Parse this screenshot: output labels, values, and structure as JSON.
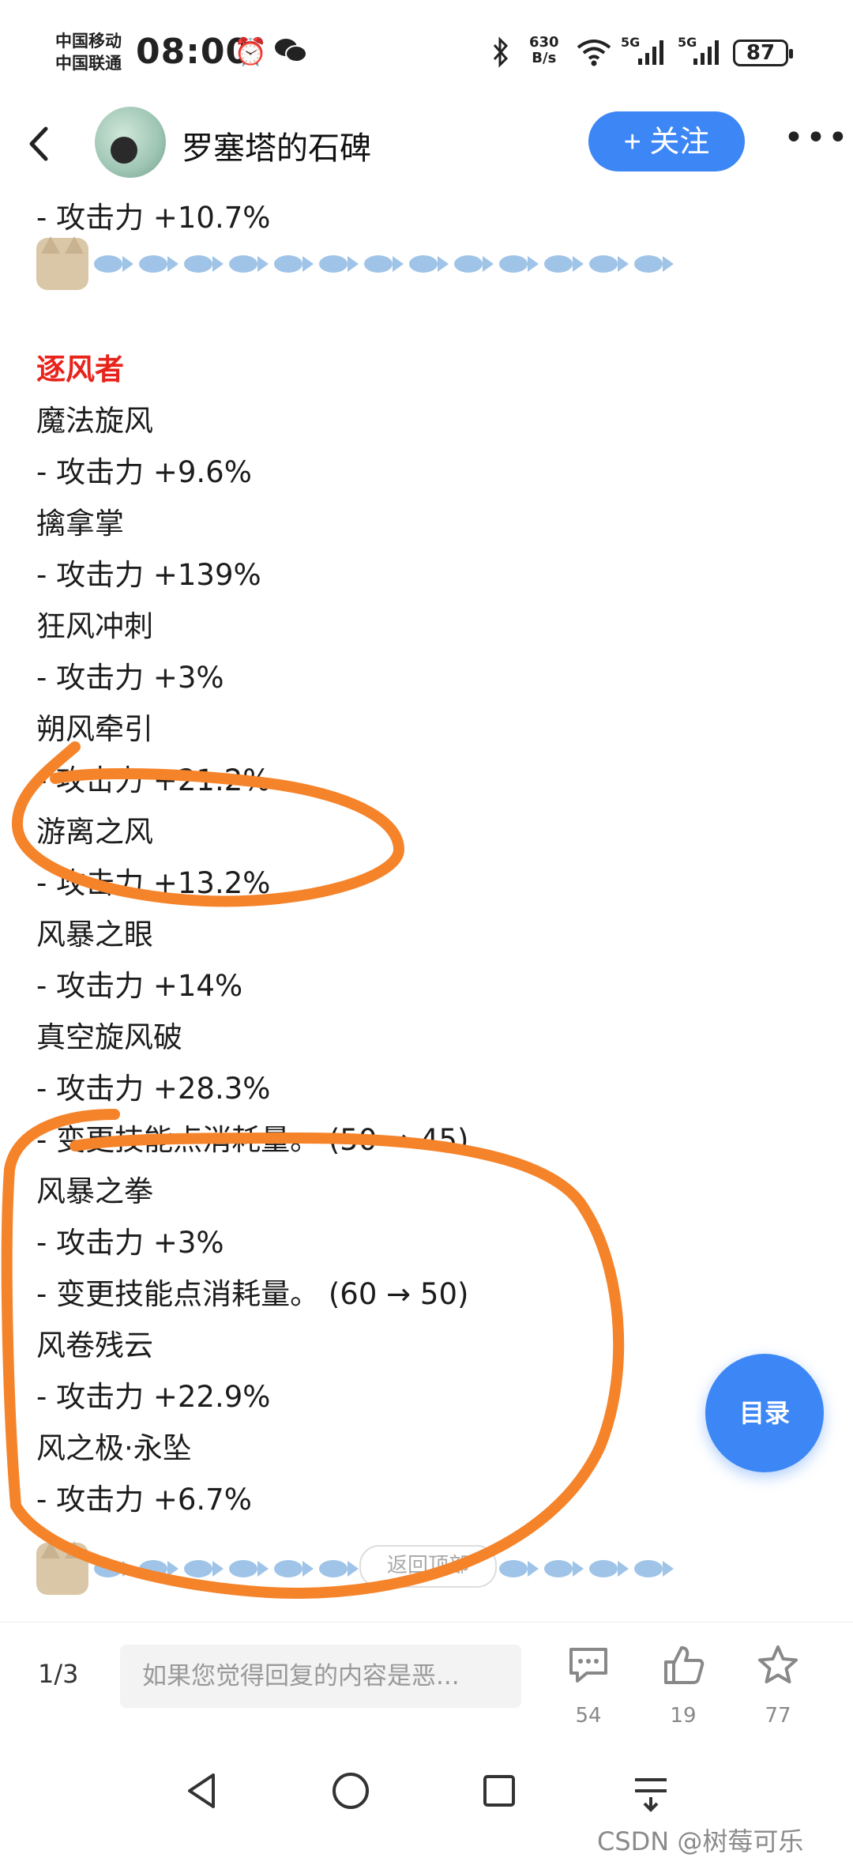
{
  "status": {
    "carrier1": "中国移动",
    "carrier2": "中国联通",
    "time": "08:00",
    "speed_value": "630",
    "speed_unit": "B/s",
    "sig1": "5G",
    "sig2": "5G",
    "battery": "87"
  },
  "header": {
    "username": "罗塞塔的石碑",
    "follow_label": "+ 关注"
  },
  "content": {
    "lines": [
      {
        "text": "- 攻击力 +10.7%",
        "type": "text"
      },
      {
        "text": "逐风者",
        "type": "title"
      },
      {
        "text": "魔法旋风",
        "type": "text"
      },
      {
        "text": "- 攻击力 +9.6%",
        "type": "text"
      },
      {
        "text": "擒拿掌",
        "type": "text"
      },
      {
        "text": "- 攻击力 +139%",
        "type": "text"
      },
      {
        "text": "狂风冲刺",
        "type": "text"
      },
      {
        "text": "- 攻击力 +3%",
        "type": "text"
      },
      {
        "text": "朔风牵引",
        "type": "text"
      },
      {
        "text": "- 攻击力 +21.2%",
        "type": "text"
      },
      {
        "text": "游离之风",
        "type": "text"
      },
      {
        "text": "- 攻击力 +13.2%",
        "type": "text"
      },
      {
        "text": "风暴之眼",
        "type": "text"
      },
      {
        "text": "- 攻击力 +14%",
        "type": "text"
      },
      {
        "text": "真空旋风破",
        "type": "text"
      },
      {
        "text": "- 攻击力 +28.3%",
        "type": "text"
      },
      {
        "text": "- 变更技能点消耗量。 (50 → 45)",
        "type": "text"
      },
      {
        "text": "风暴之拳",
        "type": "text"
      },
      {
        "text": "- 攻击力 +3%",
        "type": "text"
      },
      {
        "text": "- 变更技能点消耗量。 (60 → 50)",
        "type": "text"
      },
      {
        "text": "风卷残云",
        "type": "text"
      },
      {
        "text": "- 攻击力 +22.9%",
        "type": "text"
      },
      {
        "text": "风之极·永坠",
        "type": "text"
      },
      {
        "text": "- 攻击力 +6.7%",
        "type": "text"
      }
    ]
  },
  "toc_label": "目录",
  "back_to_top": "返回顶部",
  "bottom": {
    "page": "1/3",
    "reply_placeholder": "如果您觉得回复的内容是恶...",
    "comments": "54",
    "likes": "19",
    "favorites": "77"
  },
  "watermark": "CSDN @树莓可乐",
  "colors": {
    "accent": "#3d86f6",
    "section_title": "#e8231b",
    "annotation": "#f5832a"
  }
}
